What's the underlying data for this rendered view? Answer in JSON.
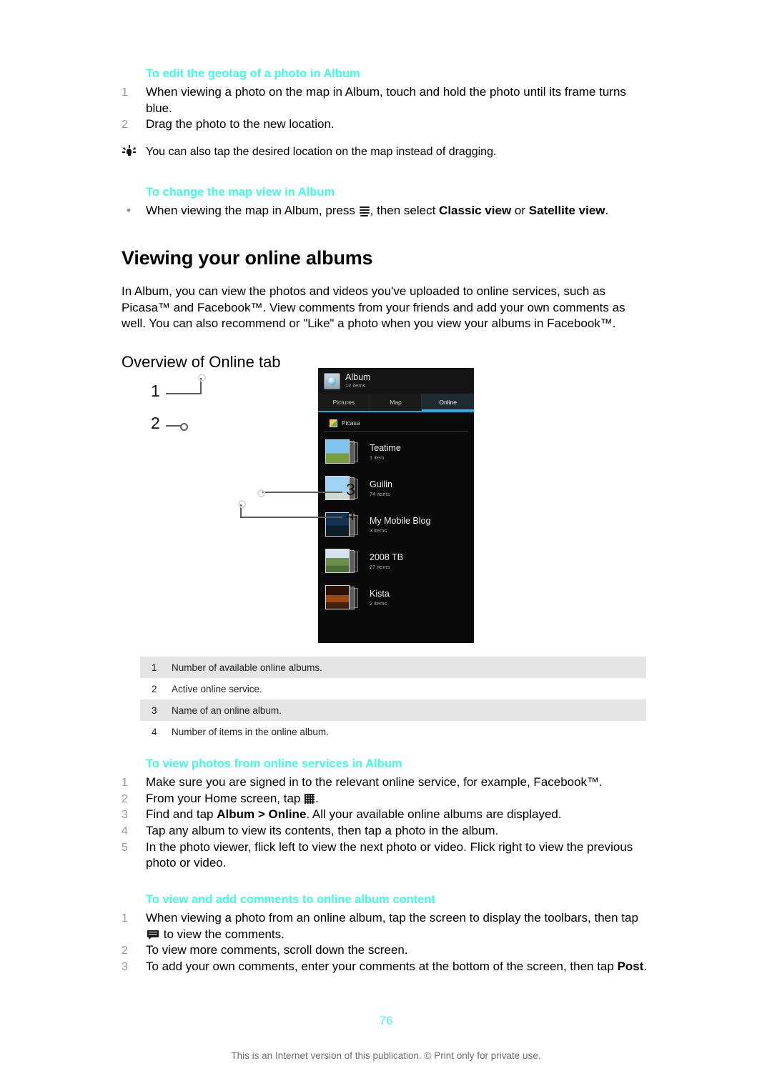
{
  "colors": {
    "heading_cyan": "#3DFFDF",
    "step_number_gray": "#9a9a9a",
    "legend_row_alt": "#e4e4e4",
    "tab_accent_blue": "#29b6e8",
    "footer_gray": "#6d6d6d"
  },
  "section_geotag": {
    "title": "To edit the geotag of a photo in Album",
    "steps": [
      {
        "num": "1",
        "text": "When viewing a photo on the map in Album, touch and hold the photo until its frame turns blue."
      },
      {
        "num": "2",
        "text": "Drag the photo to the new location."
      }
    ],
    "tip": {
      "icon": "lightbulb-icon",
      "text": "You can also tap the desired location on the map instead of dragging."
    }
  },
  "section_mapview": {
    "title": "To change the map view in Album",
    "bullet_marker": "•",
    "bullet": {
      "text_before": "When viewing the map in Album, press ",
      "icon": "menu-icon",
      "text_middle": ", then select ",
      "bold_1": "Classic view",
      "text_or": " or ",
      "bold_2": "Satellite view",
      "text_end": "."
    }
  },
  "section_main": {
    "heading": "Viewing your online albums",
    "paragraph": "In Album, you can view the photos and videos you've uploaded to online services, such as Picasa™ and Facebook™. View comments from your friends and add your own comments as well. You can also recommend or \"Like\" a photo when you view your albums in Facebook™.",
    "subheading": "Overview of Online tab"
  },
  "figure": {
    "device_screen": {
      "app_icon": "album-app-icon",
      "app_title": "Album",
      "app_subtitle": "12 items",
      "tabs": [
        {
          "label": "Pictures",
          "active": false
        },
        {
          "label": "Map",
          "active": false
        },
        {
          "label": "Online",
          "active": true
        }
      ],
      "service": {
        "icon": "picasa-icon",
        "name": "Picasa"
      },
      "albums": [
        {
          "name": "Teatime",
          "count": "1 item",
          "thumb": "th-sky"
        },
        {
          "name": "Guilin",
          "count": "74 items",
          "thumb": "th-cloud"
        },
        {
          "name": "My Mobile Blog",
          "count": "3 items",
          "thumb": "th-night"
        },
        {
          "name": "2008 TB",
          "count": "27 items",
          "thumb": "th-crowd"
        },
        {
          "name": "Kista",
          "count": "2 items",
          "thumb": "th-city"
        }
      ]
    },
    "callouts": [
      {
        "label": "1",
        "side": "left"
      },
      {
        "label": "2",
        "side": "left"
      },
      {
        "label": "3",
        "side": "right"
      },
      {
        "label": "4",
        "side": "right"
      }
    ]
  },
  "legend": {
    "rows": [
      {
        "num": "1",
        "text": "Number of available online albums."
      },
      {
        "num": "2",
        "text": "Active online service."
      },
      {
        "num": "3",
        "text": "Name of an online album."
      },
      {
        "num": "4",
        "text": "Number of items in the online album."
      }
    ]
  },
  "section_viewphotos": {
    "title": "To view photos from online services in Album",
    "steps": [
      {
        "num": "1",
        "text": "Make sure you are signed in to the relevant online service, for example, Facebook™."
      },
      {
        "num": "2",
        "text_before": "From your Home screen, tap ",
        "icon": "app-drawer-icon",
        "text_end": "."
      },
      {
        "num": "3",
        "text_before": "Find and tap ",
        "bold": "Album > Online",
        "text_end": ". All your available online albums are displayed."
      },
      {
        "num": "4",
        "text": "Tap any album to view its contents, then tap a photo in the album."
      },
      {
        "num": "5",
        "text": "In the photo viewer, flick left to view the next photo or video. Flick right to view the previous photo or video."
      }
    ]
  },
  "section_comments": {
    "title": "To view and add comments to online album content",
    "steps": [
      {
        "num": "1",
        "text_before": "When viewing a photo from an online album, tap the screen to display the toolbars, then tap ",
        "icon": "comment-icon",
        "text_end": " to view the comments."
      },
      {
        "num": "2",
        "text": "To view more comments, scroll down the screen."
      },
      {
        "num": "3",
        "text_before": "To add your own comments, enter your comments at the bottom of the screen, then tap ",
        "bold": "Post",
        "text_end": "."
      }
    ]
  },
  "footer": {
    "page_number": "76",
    "note": "This is an Internet version of this publication. © Print only for private use."
  }
}
